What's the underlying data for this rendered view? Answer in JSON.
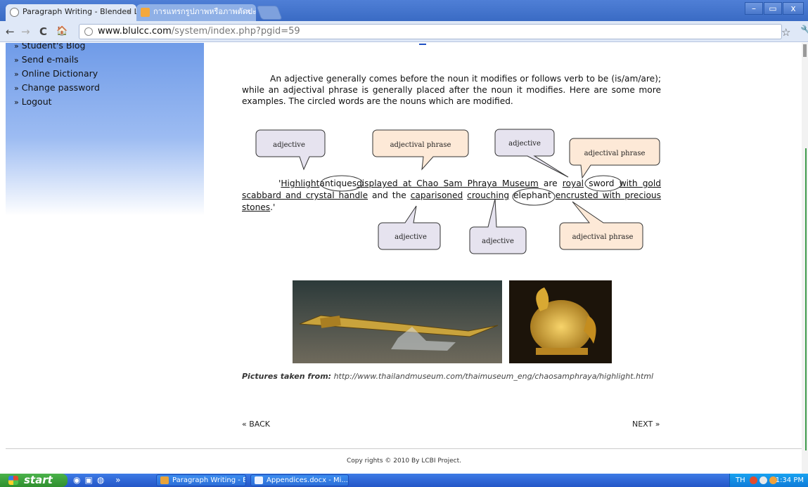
{
  "browser": {
    "tabs": [
      {
        "label": "Paragraph Writing - Blended Le",
        "active": true
      },
      {
        "label": "การแทรกรูปภาพหรือภาพตัดปะ -",
        "active": false
      }
    ],
    "close_glyph": "×",
    "url_host": "www.blulcc.com",
    "url_path": "/system/index.php?pgid=59",
    "nav": {
      "back": "←",
      "forward": "→",
      "reload": "C",
      "home": "🏠",
      "star": "☆",
      "wrench": "🔧"
    },
    "window_buttons": [
      "–",
      "▭",
      "x"
    ]
  },
  "sidebar": {
    "items": [
      {
        "label": "Student's Blog"
      },
      {
        "label": "Send e-mails"
      },
      {
        "label": "Online Dictionary"
      },
      {
        "label": "Change password"
      },
      {
        "label": "Logout"
      }
    ],
    "bullet": "»"
  },
  "content": {
    "paragraph": "An adjective generally comes before the noun it modifies or follows verb to be (is/am/are); while an adjectival phrase is generally placed after the noun it modifies. Here are some more examples. The circled words are the nouns which are modified.",
    "sentence": {
      "open_quote": "'",
      "w_highlight": "Highlight",
      "w_antiques": "antiques",
      "w_displayed": "displayed at Chao Sam Phraya Museum",
      "t_are": " are ",
      "w_royal": "royal",
      "w_sword": "sword",
      "w_with": "with gold scabbard and crystal handle",
      "t_and_the": " and the ",
      "w_caparisoned": "caparisoned",
      "t_space": " ",
      "w_crouching": "crouching",
      "w_elephant": "elephant",
      "w_encrusted": "encrusted with precious stones",
      "close_quote": ".'"
    },
    "callouts": {
      "c1": "adjective",
      "c2": "adjectival phrase",
      "c3": "adjective",
      "c4": "adjectival phrase",
      "c5": "adjective",
      "c6": "adjective",
      "c7": "adjectival phrase"
    },
    "pictures_caption_label": "Pictures taken from:",
    "pictures_caption_url": "http://www.thailandmuseum.com/thaimuseum_eng/chaosamphraya/highlight.html",
    "back": "« BACK",
    "next": "NEXT »",
    "footer": "Copy rights © 2010 By LCBI Project."
  },
  "taskbar": {
    "start": "start",
    "quick_launch": "» ",
    "items": [
      {
        "label": "Paragraph Writing - B..."
      },
      {
        "label": "Appendices.docx - Mi..."
      }
    ],
    "lang": "TH",
    "clock": "1:34 PM"
  },
  "colors": {
    "callout_lavender": "#e6e3ef",
    "callout_peach": "#fde9d7",
    "sidebar_blue": "#6f9be8",
    "taskbar_blue": "#2456c7"
  }
}
